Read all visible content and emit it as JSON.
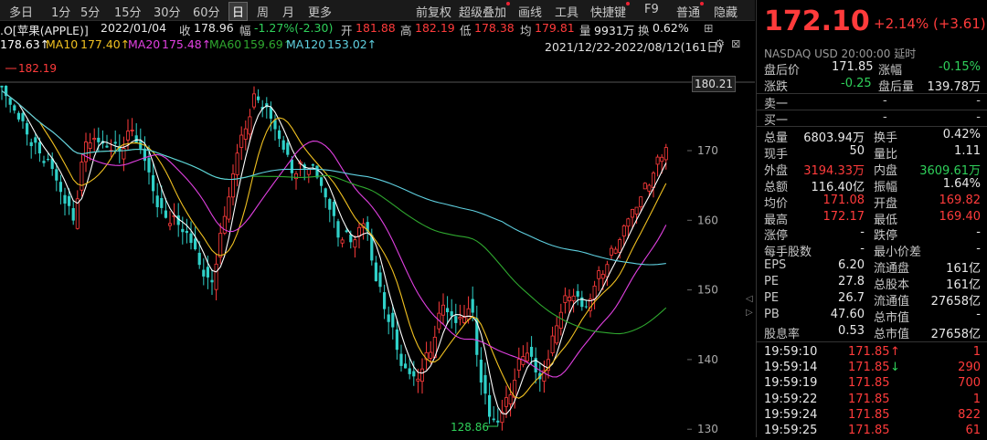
{
  "toolbar": {
    "periods": [
      "多日",
      "1分",
      "5分",
      "15分",
      "30分",
      "60分",
      "日",
      "周",
      "月",
      "更多"
    ],
    "active_period": "日",
    "tools": [
      "前复权",
      "超级叠加",
      "画线",
      "工具",
      "快捷键",
      "F9",
      "普通",
      "隐藏"
    ]
  },
  "ma": {
    "ma5_label": "178.63↑",
    "ma10": "MA10",
    "ma10_val": "177.40↑",
    "ma20": "MA20",
    "ma20_val": "175.48↑",
    "ma60": "MA60",
    "ma60_val": "159.69↑",
    "ma120": "MA120",
    "ma120_val": "153.02↑",
    "range": "2021/12/22-2022/08/12(161日)"
  },
  "info": {
    "name": ".O[苹果(APPLE)]",
    "date": "2022/01/04",
    "close_label": "收",
    "close": "178.96",
    "amp_label": "幅",
    "amp": "-1.27%(-2.30)",
    "open_label": "开",
    "open": "181.88",
    "high_label": "高",
    "high": "182.19",
    "low_label": "低",
    "low": "178.38",
    "amount_label": "均",
    "amount": "179.81",
    "volume_label": "量",
    "volume": "9931万",
    "turnover_label": "换",
    "turnover": "0.62%"
  },
  "chart_labels": {
    "max": "182.19",
    "min": "128.86",
    "cursor": "180.21"
  },
  "axis": {
    "ticks": [
      "170",
      "160",
      "150",
      "140",
      "130"
    ]
  },
  "colors": {
    "up": "#ff3b3b",
    "down": "#2fd0c8",
    "ma5": "#ffffff",
    "ma10": "#f0c020",
    "ma20": "#e040e0",
    "ma60": "#2fa82f",
    "ma120": "#5fd0e0"
  },
  "quote": {
    "price": "172.10",
    "change": "+2.14% (+3.61)",
    "exchange": "NASDAQ  USD  20:00:00  延时",
    "after_price_label": "盘后价",
    "after_price": "171.85",
    "after_pct_label": "涨幅",
    "after_pct": "-0.15%",
    "after_chg_label": "涨跌",
    "after_chg": "-0.25",
    "after_vol_label": "盘后量",
    "after_vol": "139.78万",
    "sell1": "卖一",
    "buy1": "买一",
    "dash": "-"
  },
  "stats": [
    [
      "总量",
      "6803.94万",
      "换手",
      "0.42%"
    ],
    [
      "现手",
      "50",
      "量比",
      "1.11"
    ],
    [
      "外盘",
      "3194.33万",
      "内盘",
      "3609.61万"
    ],
    [
      "总额",
      "116.40亿",
      "振幅",
      "1.64%"
    ],
    [
      "均价",
      "171.08",
      "开盘",
      "169.82"
    ],
    [
      "最高",
      "172.17",
      "最低",
      "169.40"
    ],
    [
      "涨停",
      "-",
      "跌停",
      "-"
    ],
    [
      "每手股数",
      "-",
      "最小价差",
      "-"
    ],
    [
      "EPS",
      "6.20",
      "流通盘",
      "161亿"
    ],
    [
      "PE",
      "27.8",
      "总股本",
      "161亿"
    ],
    [
      "PE",
      "26.7",
      "流通值",
      "27658亿"
    ],
    [
      "PB",
      "47.60",
      "总市值",
      "-"
    ],
    [
      "股息率",
      "0.53",
      "总市值",
      "27658亿"
    ]
  ],
  "ticks": [
    [
      "19:59:10",
      "171.85",
      "↑",
      "1"
    ],
    [
      "19:59:14",
      "171.85",
      "↓",
      "290"
    ],
    [
      "19:59:19",
      "171.85",
      "",
      "700"
    ],
    [
      "19:59:22",
      "171.85",
      "",
      "1"
    ],
    [
      "19:59:24",
      "171.85",
      "",
      "822"
    ],
    [
      "19:59:25",
      "171.85",
      "",
      "61"
    ]
  ]
}
